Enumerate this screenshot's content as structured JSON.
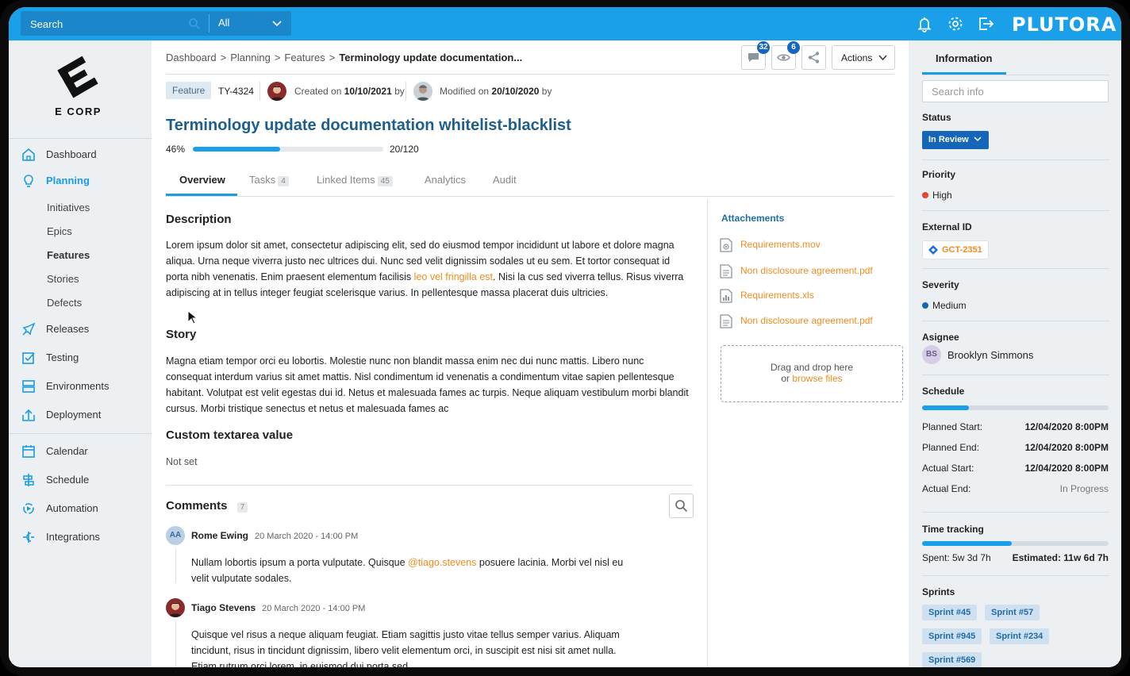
{
  "topbar": {
    "search_placeholder": "Search",
    "scope": "All",
    "brand": "PLUTORA"
  },
  "sidebar": {
    "logo_text": "E CORP",
    "items": [
      {
        "label": "Dashboard",
        "icon": "home-icon"
      },
      {
        "label": "Planning",
        "icon": "lightbulb-icon",
        "active": true
      },
      {
        "label": "Releases",
        "icon": "rocket-icon"
      },
      {
        "label": "Testing",
        "icon": "checkbox-icon"
      },
      {
        "label": "Environments",
        "icon": "server-icon"
      },
      {
        "label": "Deployment",
        "icon": "deploy-icon"
      },
      {
        "label": "Calendar",
        "icon": "calendar-icon"
      },
      {
        "label": "Schedule",
        "icon": "schedule-icon"
      },
      {
        "label": "Automation",
        "icon": "automation-icon"
      },
      {
        "label": "Integrations",
        "icon": "integrations-icon"
      }
    ],
    "sub_items": [
      "Initiatives",
      "Epics",
      "Features",
      "Stories",
      "Defects"
    ],
    "current_sub": "Features"
  },
  "main": {
    "breadcrumb": [
      "Dashboard",
      "Planning",
      "Features",
      "Terminology update documentation..."
    ],
    "comments_badge": "32",
    "watchers_badge": "6",
    "actions_label": "Actions",
    "meta": {
      "type_tag": "Feature",
      "id": "TY-4324",
      "created_prefix": "Created on",
      "created_date": "10/10/2021",
      "created_suffix": "by",
      "modified_prefix": "Modified on",
      "modified_date": "20/10/2020",
      "modified_suffix": "by"
    },
    "title": "Terminology update documentation whitelist-blacklist",
    "progress": {
      "percent_label": "46%",
      "fraction": 0.46,
      "count": "20/120"
    },
    "tabs": [
      {
        "label": "Overview",
        "count": ""
      },
      {
        "label": "Tasks",
        "count": "4"
      },
      {
        "label": "Linked Items",
        "count": "45"
      },
      {
        "label": "Analytics",
        "count": ""
      },
      {
        "label": "Audit",
        "count": ""
      }
    ],
    "description": {
      "heading": "Description",
      "text_before": "Lorem ipsum dolor sit amet, consectetur adipiscing elit, sed do eiusmod tempor incididunt ut labore et dolore magna aliqua. Urna neque viverra justo nec ultrices dui. Nunc sed velit dignissim sodales ut eu sem. Et tortor consequat id porta nibh venenatis. Enim praesent elementum facilisis ",
      "link": "leo vel fringilla est",
      "text_after": ". Nisi la cus sed viverra tellus. Risus viverra adipiscing at in tellus integer feugiat scelerisque varius. In pellentesque massa placerat duis ultricies."
    },
    "story": {
      "heading": "Story",
      "text": "Magna etiam tempor orci eu lobortis. Molestie nunc non blandit massa enim nec dui nunc mattis. Libero nunc consequat interdum varius sit amet mattis. Nisl condimentum id venenatis a condimentum vitae sapien pellentesque habitant. Volutpat est velit egestas dui id. Netus et malesuada fames ac turpis. Neque aliquam vestibulum morbi blandit cursus. Morbi tristique senectus et netus et malesuada fames ac"
    },
    "custom": {
      "heading": "Custom textarea value",
      "value": "Not set"
    },
    "comments": {
      "heading": "Comments",
      "count": "7",
      "items": [
        {
          "initials": "AA",
          "author": "Rome Ewing",
          "date": "20 March 2020 - 14:00 PM",
          "before": "Nullam lobortis ipsum a porta vulputate. Quisque ",
          "mention": "@tiago.stevens",
          "after": " posuere lacinia. Morbi vel nisl eu velit vulputate sodales."
        },
        {
          "author": "Tiago Stevens",
          "date": "20 March 2020 - 14:00 PM",
          "text": "Quisque vel risus a neque aliquam feugiat. Etiam sagittis justo vitae tellus semper varius. Aliquam tincidunt, risus in tincidunt dignissim, libero velit elementum orci, in suscipit est nisi sit amet nulla. Etiam rutrum orci lorem, in euismod dui porta sed."
        }
      ]
    },
    "attachments": {
      "heading": "Attachements",
      "files": [
        {
          "name": "Requirements.mov",
          "icon": "video-file-icon"
        },
        {
          "name": "Non disclosoure agreement.pdf",
          "icon": "document-file-icon"
        },
        {
          "name": "Requirements.xls",
          "icon": "spreadsheet-file-icon"
        },
        {
          "name": "Non disclosoure agreement.pdf",
          "icon": "document-file-icon"
        }
      ],
      "drop_line1": "Drag and drop here",
      "drop_or": "or ",
      "drop_link": "browse files"
    }
  },
  "info": {
    "tab": "Information",
    "search_placeholder": "Search info",
    "status_label": "Status",
    "status_value": "In Review",
    "priority_label": "Priority",
    "priority_value": "High",
    "priority_color": "#e8442e",
    "external_label": "External ID",
    "external_value": "GCT-2351",
    "severity_label": "Severity",
    "severity_value": "Medium",
    "severity_color": "#1565b8",
    "assignee_label": "Asignee",
    "assignee_initials": "BS",
    "assignee_name": "Brooklyn Simmons",
    "schedule_label": "Schedule",
    "schedule_fraction": 0.25,
    "schedule": [
      {
        "k": "Planned Start:",
        "v": "12/04/2020 8:00PM"
      },
      {
        "k": "Planned End:",
        "v": "12/04/2020 8:00PM"
      },
      {
        "k": "Actual Start:",
        "v": "12/04/2020 8:00PM"
      },
      {
        "k": "Actual End:",
        "v": "In Progress"
      }
    ],
    "time_label": "Time tracking",
    "time_fraction": 0.48,
    "spent": "Spent: 5w 3d 7h",
    "estimated": "Estimated: 11w 6d 7h",
    "sprints_label": "Sprints",
    "sprints": [
      "Sprint #45",
      "Sprint #57",
      "Sprint #945",
      "Sprint #234",
      "Sprint #569"
    ]
  },
  "colors": {
    "accent": "#1aa0e8",
    "title": "#1e5e8f",
    "link": "#f08c1e",
    "status": "#1565b8"
  }
}
